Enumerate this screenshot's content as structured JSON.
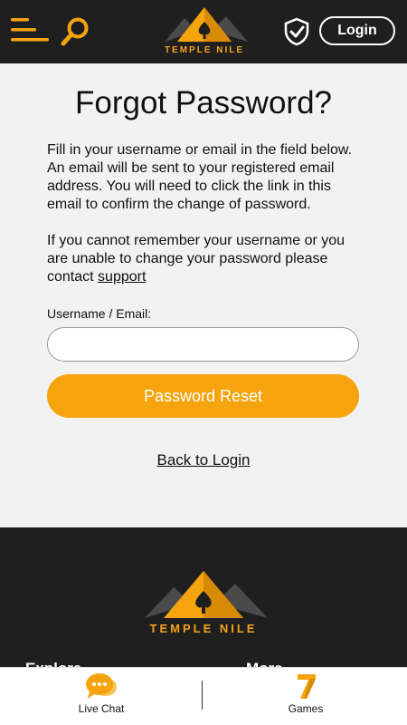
{
  "header": {
    "logo_text": "TEMPLE NILE",
    "login_label": "Login"
  },
  "main": {
    "title": "Forgot Password?",
    "paragraph1": "Fill in your username or email in the field below. An email will be sent to your registered email address. You will need to click the link in this email to confirm the change of password.",
    "paragraph2_text": "If you cannot remember your username or you are unable to change your password please contact",
    "support_link": "support",
    "field_label": "Username / Email:",
    "field_value": "",
    "field_placeholder": "",
    "reset_button": "Password Reset",
    "back_link": "Back to Login"
  },
  "footer": {
    "logo_text": "TEMPLE NILE",
    "columns": [
      "Explore",
      "More"
    ]
  },
  "bottom_bar": {
    "tabs": [
      {
        "label": "Live Chat",
        "icon": "chat-bubble-icon"
      },
      {
        "label": "Games",
        "icon": "seven-icon"
      }
    ]
  },
  "colors": {
    "accent": "#f6a40d",
    "header_bg": "#1f1f1f",
    "page_bg": "#f2f2f2"
  }
}
